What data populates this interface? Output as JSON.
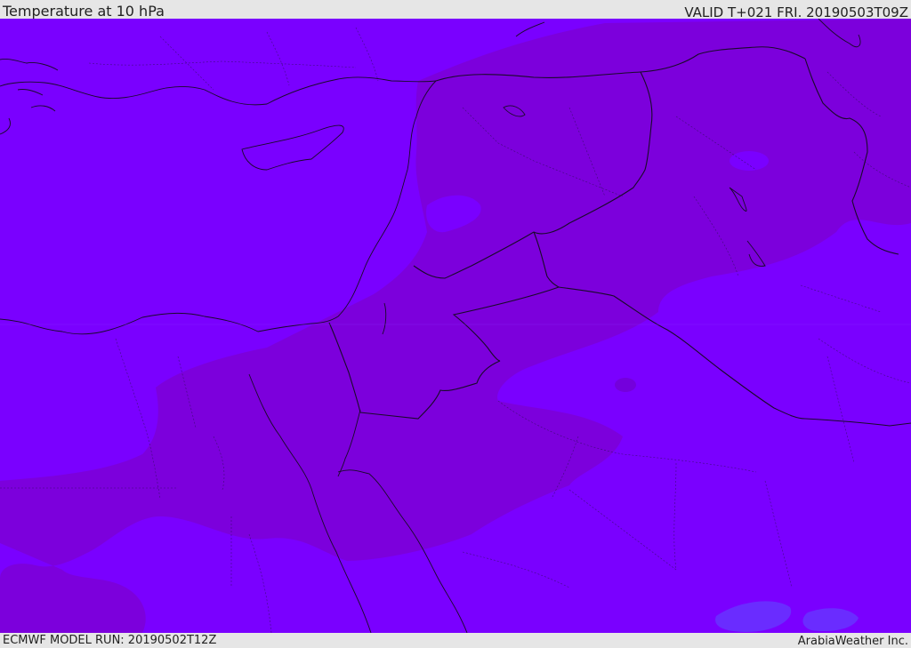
{
  "header": {
    "title": "Temperature at 10 hPa",
    "valid_time": "VALID T+021 FRI. 20190503T09Z"
  },
  "footer": {
    "model_run": "ECMWF MODEL RUN: 20190502T12Z",
    "credit": "ArabiaWeather Inc."
  },
  "map": {
    "colors": {
      "background_field": "#7a00ff",
      "cold_band": "#7c00dc",
      "warm_patch": "#6a2cff"
    }
  }
}
